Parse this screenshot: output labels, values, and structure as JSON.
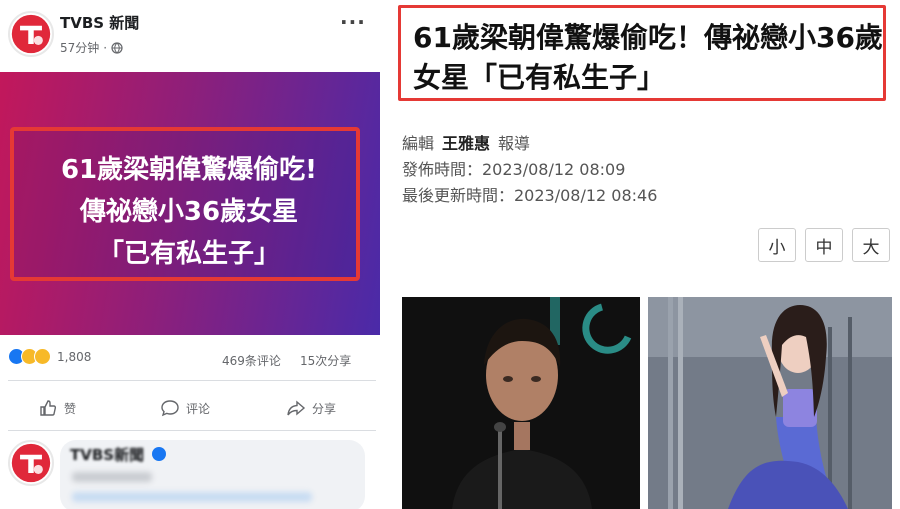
{
  "post": {
    "page_name": "TVBS 新聞",
    "time": "57分钟",
    "banner_lines": [
      "61歲梁朝偉驚爆偷吃!",
      "傳祕戀小36歲女星",
      "「已有私生子」"
    ],
    "reaction_count": "1,808",
    "comments": "469条评论",
    "shares": "15次分享",
    "actions": {
      "like": "赞",
      "comment": "评论",
      "share": "分享"
    },
    "comment_author": "TVBS新聞"
  },
  "article": {
    "headline": "61歲梁朝偉驚爆偷吃！傳祕戀小36歲女星「已有私生子」",
    "editor_label": "編輯",
    "editor_name": "王雅惠",
    "editor_suffix": "報導",
    "published": "發佈時間：2023/08/12 08:09",
    "updated": "最後更新時間：2023/08/12 08:46",
    "font_sizes": [
      "小",
      "中",
      "大"
    ]
  },
  "colors": {
    "highlight_red": "#e53935",
    "facebook_blue": "#1877f2",
    "tvbs_red": "#e0283a"
  }
}
